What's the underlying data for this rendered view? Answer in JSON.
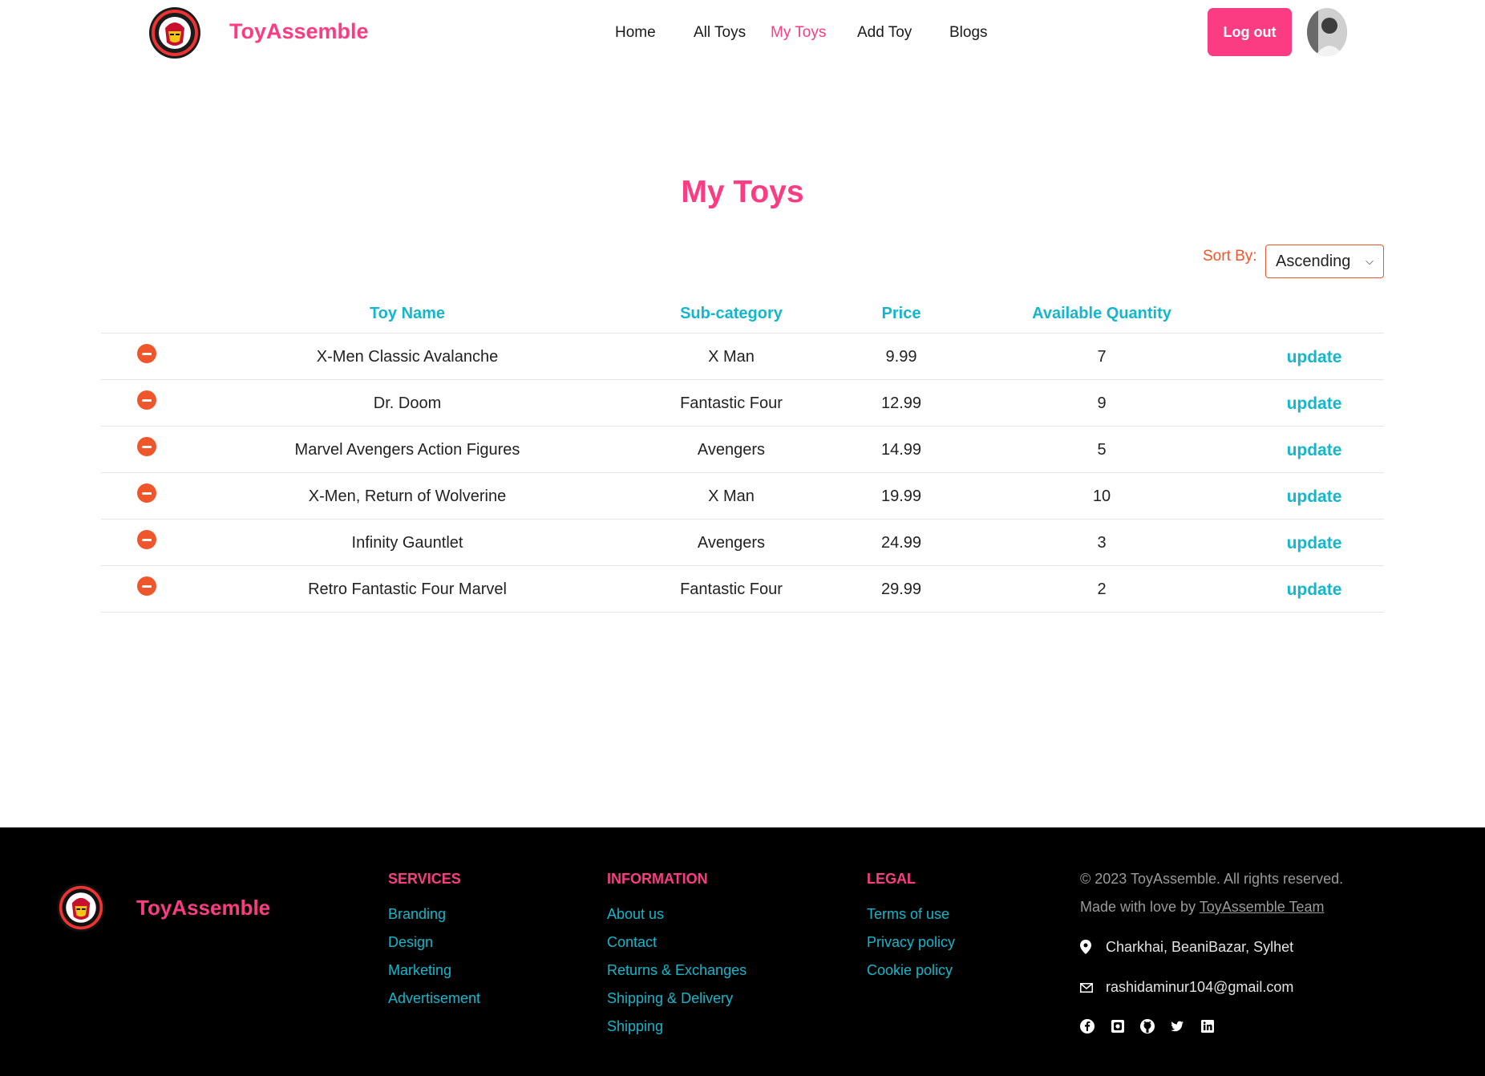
{
  "brand": {
    "name": "ToyAssemble",
    "accent": "#fb3c83",
    "cyan": "#13b7cc",
    "orange": "#f0562b"
  },
  "nav": {
    "links": [
      "Home",
      "All Toys",
      "My Toys",
      "Add Toy",
      "Blogs"
    ],
    "active": "My Toys",
    "logout_label": "Log out"
  },
  "main": {
    "title": "My Toys",
    "sort_label": "Sort By:",
    "sort_value": "Ascending",
    "headers": [
      "Toy Name",
      "Sub-category",
      "Price",
      "Available Quantity"
    ],
    "update_label": "update",
    "rows": [
      {
        "name": "X-Men Classic Avalanche",
        "subcategory": "X Man",
        "price": "9.99",
        "qty": "7"
      },
      {
        "name": "Dr. Doom",
        "subcategory": "Fantastic Four",
        "price": "12.99",
        "qty": "9"
      },
      {
        "name": "Marvel Avengers Action Figures",
        "subcategory": "Avengers",
        "price": "14.99",
        "qty": "5"
      },
      {
        "name": "X-Men, Return of Wolverine",
        "subcategory": "X Man",
        "price": "19.99",
        "qty": "10"
      },
      {
        "name": "Infinity Gauntlet",
        "subcategory": "Avengers",
        "price": "24.99",
        "qty": "3"
      },
      {
        "name": "Retro Fantastic Four Marvel",
        "subcategory": "Fantastic Four",
        "price": "29.99",
        "qty": "2"
      }
    ]
  },
  "footer": {
    "brand": "ToyAssemble",
    "services": {
      "title": "SERVICES",
      "items": [
        "Branding",
        "Design",
        "Marketing",
        "Advertisement"
      ]
    },
    "information": {
      "title": "INFORMATION",
      "items": [
        "About us",
        "Contact",
        "Returns & Exchanges",
        "Shipping & Delivery",
        "Shipping"
      ]
    },
    "legal": {
      "title": "LEGAL",
      "items": [
        "Terms of use",
        "Privacy policy",
        "Cookie policy"
      ]
    },
    "copyright": "© 2023 ToyAssemble. All rights reserved.",
    "made_with": "Made with love by",
    "team": "ToyAssemble Team",
    "address": "Charkhai, BeaniBazar, Sylhet",
    "email": "rashidaminur104@gmail.com",
    "socials": [
      "facebook-icon",
      "instagram-icon",
      "github-icon",
      "twitter-icon",
      "linkedin-icon"
    ]
  }
}
